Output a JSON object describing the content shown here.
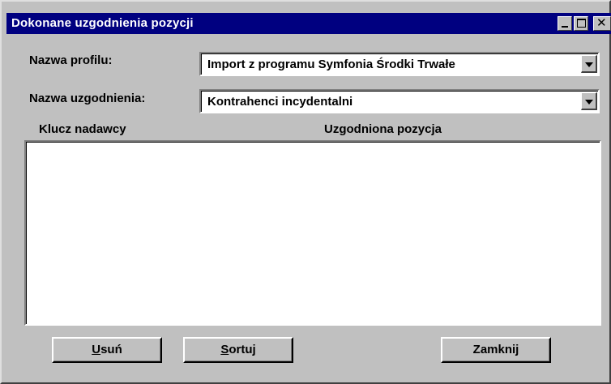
{
  "window": {
    "title": "Dokonane uzgodnienia pozycji",
    "title_bg": "#000080",
    "face": "#c0c0c0",
    "controls": {
      "minimize": "minimize-icon",
      "maximize": "maximize-icon",
      "close": "close-icon",
      "close_glyph": "✕"
    }
  },
  "form": {
    "profile": {
      "label": "Nazwa profilu:",
      "value": "Import z programu Symfonia Środki Trwałe"
    },
    "reconciliation": {
      "label": "Nazwa uzgodnienia:",
      "value": "Kontrahenci incydentalni"
    }
  },
  "list": {
    "columns": [
      "Klucz nadawcy",
      "Uzgodniona pozycja"
    ],
    "rows": []
  },
  "buttons": {
    "delete": {
      "mnemonic": "U",
      "rest": "suń"
    },
    "sort": {
      "mnemonic": "S",
      "rest": "ortuj"
    },
    "close": {
      "label": "Zamknij"
    }
  }
}
